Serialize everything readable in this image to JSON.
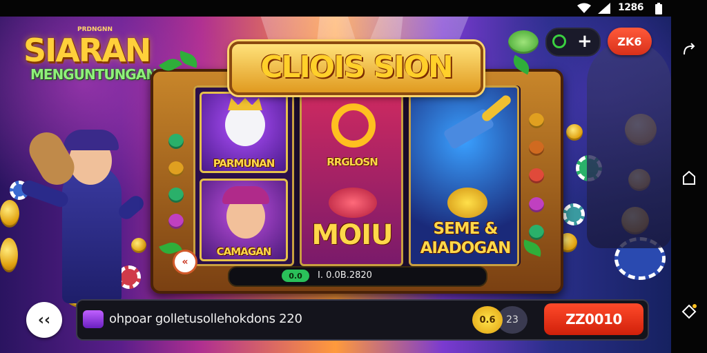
{
  "status_bar": {
    "time": "1286"
  },
  "logo": {
    "small_text": "PRDNGNN",
    "title": "SIARAN",
    "subtitle": "MENGUNTUNGAN"
  },
  "top_right": {
    "coin_button_icon": "plus-icon",
    "zk_label": "ZK6"
  },
  "banner": {
    "title": "CLIOIS SION"
  },
  "reels": {
    "tiles": [
      {
        "label": "PARMUNAN",
        "character": "cat-king-icon"
      },
      {
        "label": "CAMAGAN",
        "character": "princess-icon"
      },
      {
        "label": "RRGLOSN",
        "character": "golden-symbol-icon"
      },
      {
        "label": "MOIU",
        "character": "coin-pile-icon"
      },
      {
        "label": "",
        "character": "hammer-icon"
      },
      {
        "label": "SEME & AIADOGAN",
        "character": "gold-coin-icon"
      }
    ]
  },
  "mini_bar": {
    "pill": "0.0",
    "text": "I. 0.0B.2820"
  },
  "bottom_bar": {
    "message": "ohpoar golletusollehokdons 220",
    "coin_a": "0.6",
    "coin_b": "23",
    "spin_label": "ZZ0010"
  },
  "colors": {
    "accent": "#ff4a2a",
    "gold": "#ffd03a",
    "green": "#3ad040"
  }
}
